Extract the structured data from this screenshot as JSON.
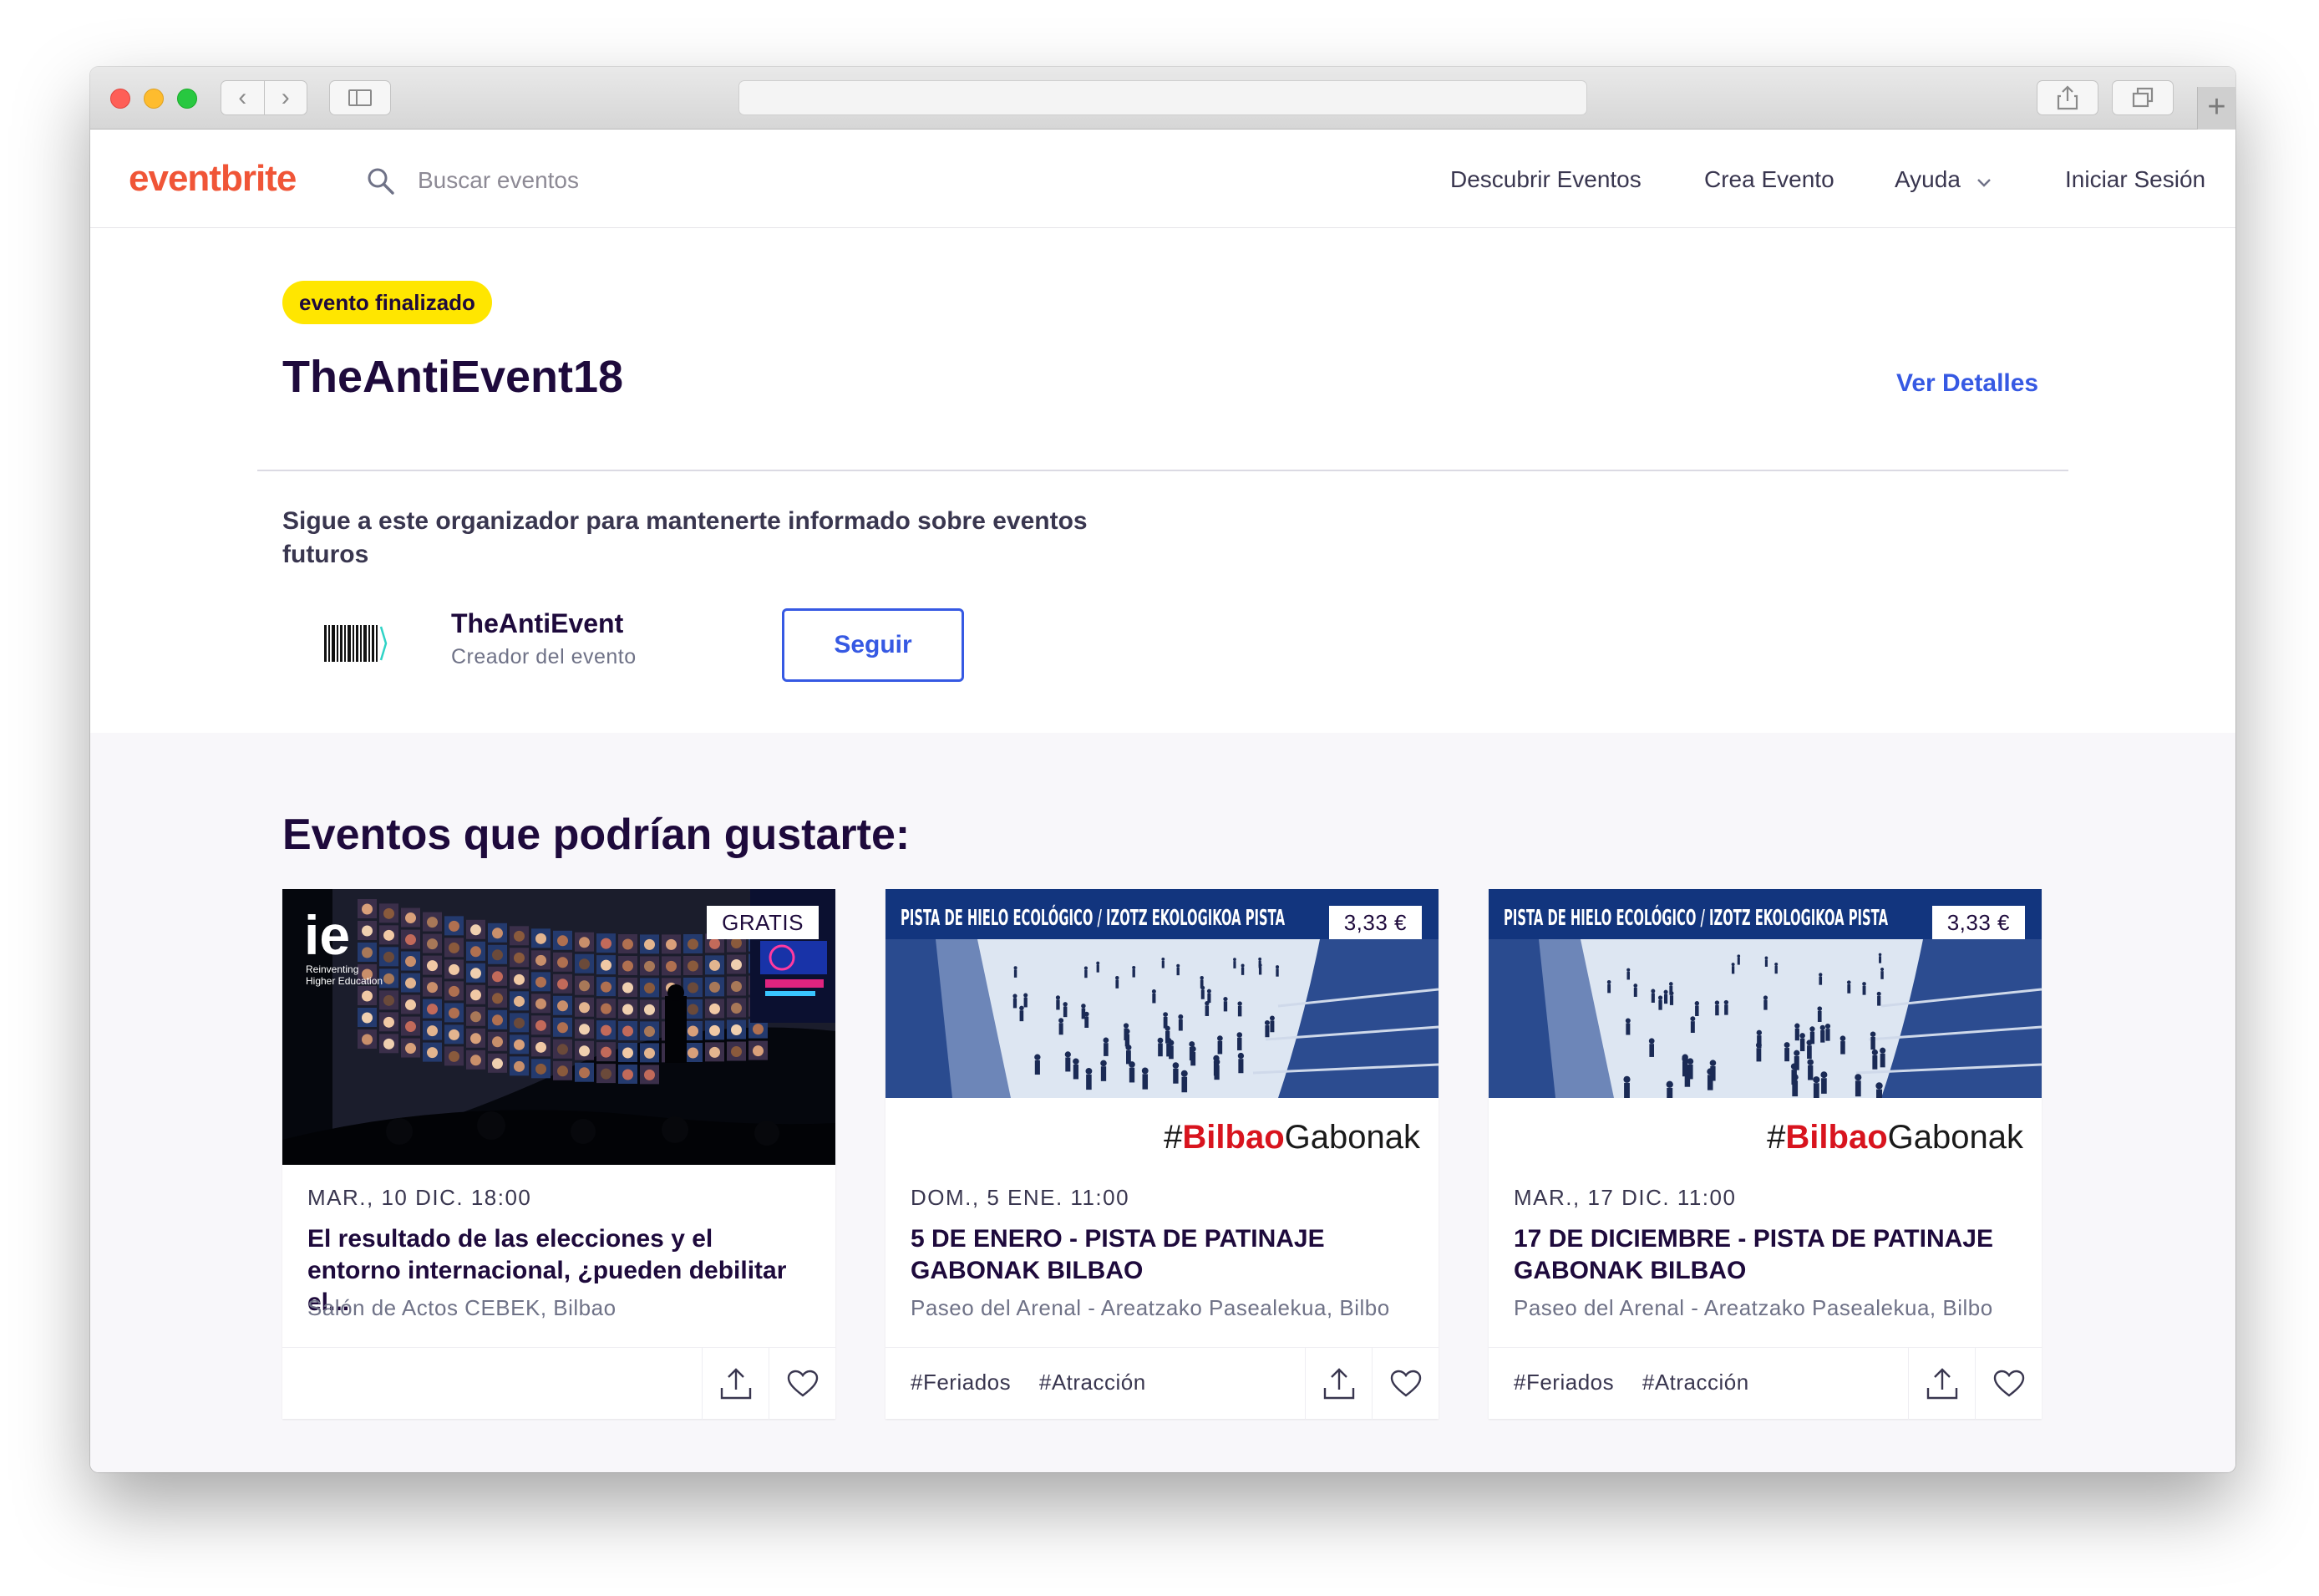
{
  "header": {
    "logo": "eventbrite",
    "search_placeholder": "Buscar eventos",
    "nav": {
      "discover": "Descubrir Eventos",
      "create": "Crea Evento",
      "help": "Ayuda",
      "login": "Iniciar Sesión"
    }
  },
  "event": {
    "status_badge": "evento finalizado",
    "title": "TheAntiEvent18",
    "details_link": "Ver Detalles"
  },
  "organizer": {
    "follow_prompt": "Sigue a este organizador para mantenerte informado sobre eventos futuros",
    "name": "TheAntiEvent",
    "role": "Creador del evento",
    "follow_button": "Seguir"
  },
  "recommendations": {
    "heading": "Eventos que podrían gustarte:",
    "cards": [
      {
        "price": "GRATIS",
        "date": "MAR., 10 DIC. 18:00",
        "title": "El resultado de las elecciones y el entorno internacional, ¿pueden debilitar el...",
        "venue": "Salón de Actos CEBEK, Bilbao",
        "tags": [],
        "image_logo": "ie",
        "image_tagline_1": "Reinventing",
        "image_tagline_2": "Higher Education"
      },
      {
        "price": "3,33 €",
        "date": "DOM., 5 ENE. 11:00",
        "title": "5 DE ENERO - PISTA DE PATINAJE GABONAK BILBAO",
        "venue": "Paseo del Arenal - Areatzako Pasealekua, Bilbo",
        "tags": [
          "#Feriados",
          "#Atracción"
        ],
        "banner": "PISTA DE HIELO ECOLÓGICO / IZOTZ EKOLOGIKOA PISTA",
        "hashtag_prefix": "#",
        "hashtag_red": "Bilbao",
        "hashtag_rest": "Gabonak"
      },
      {
        "price": "3,33 €",
        "date": "MAR., 17 DIC. 11:00",
        "title": "17 DE DICIEMBRE - PISTA DE PATINAJE GABONAK BILBAO",
        "venue": "Paseo del Arenal - Areatzako Pasealekua, Bilbo",
        "tags": [
          "#Feriados",
          "#Atracción"
        ],
        "banner": "PISTA DE HIELO ECOLÓGICO / IZOTZ EKOLOGIKOA PISTA",
        "hashtag_prefix": "#",
        "hashtag_red": "Bilbao",
        "hashtag_rest": "Gabonak"
      }
    ]
  },
  "colors": {
    "brand": "#f05537",
    "link": "#3659e3",
    "badge": "#ffe600",
    "heading": "#1e0a3c",
    "hashtag_red": "#d8141e"
  },
  "icons": {
    "search": "search-icon",
    "help_dropdown": "chevron-down-icon",
    "share": "share-icon",
    "like": "heart-icon"
  }
}
